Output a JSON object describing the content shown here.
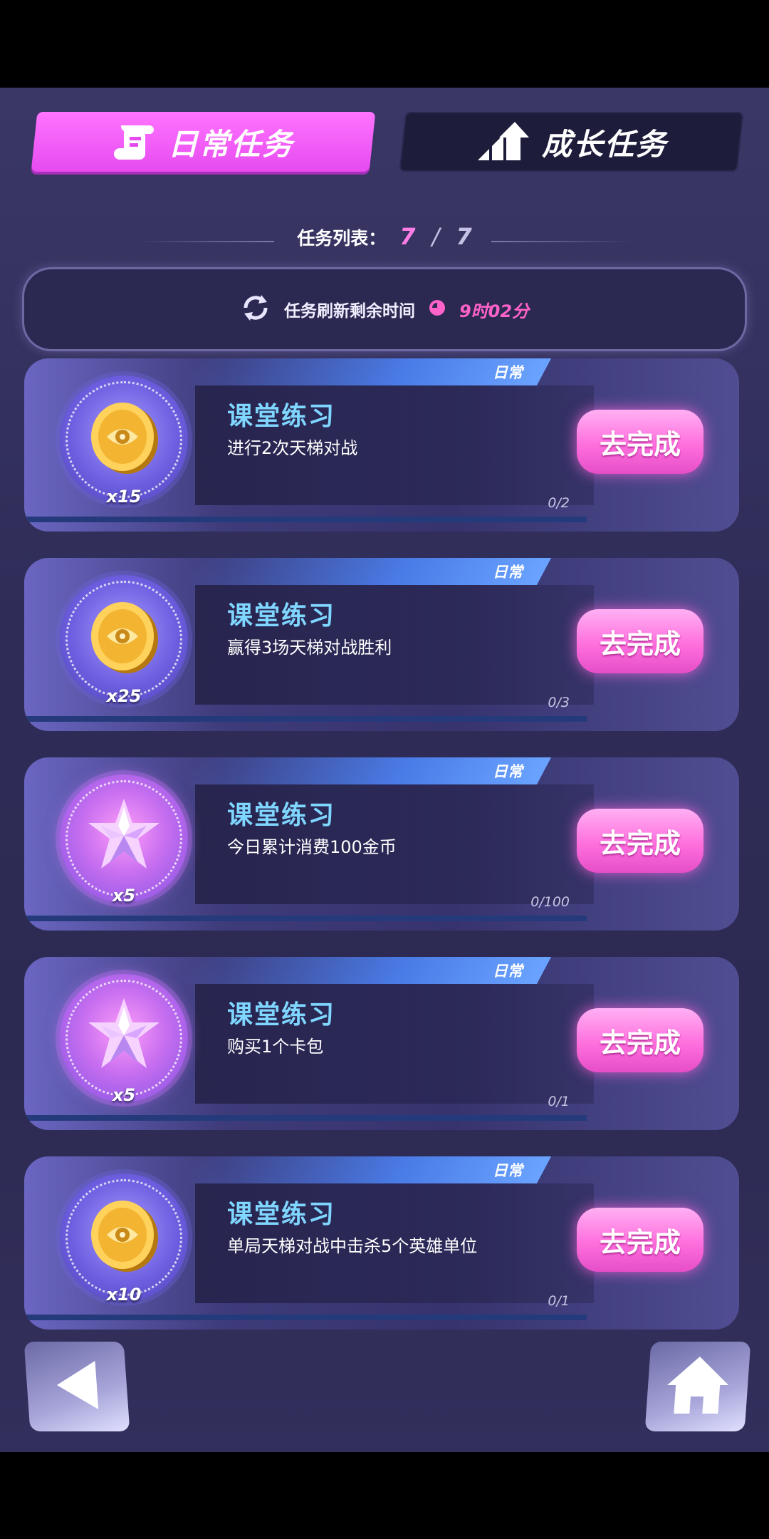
{
  "tabs": {
    "daily_label": "日常任务",
    "growth_label": "成长任务"
  },
  "task_count": {
    "label": "任务列表：",
    "current": "7",
    "separator": "/",
    "total": "7"
  },
  "refresh": {
    "label": "任务刷新剩余时间",
    "time": "9时02分"
  },
  "tasks": [
    {
      "tag": "日常",
      "title": "课堂练习",
      "desc": "进行2次天梯对战",
      "reward_icon": "coin-icon",
      "reward_qty": "x15",
      "progress": "0/2",
      "button": "去完成"
    },
    {
      "tag": "日常",
      "title": "课堂练习",
      "desc": "赢得3场天梯对战胜利",
      "reward_icon": "coin-icon",
      "reward_qty": "x25",
      "progress": "0/3",
      "button": "去完成"
    },
    {
      "tag": "日常",
      "title": "课堂练习",
      "desc": "今日累计消费100金币",
      "reward_icon": "star-crystal-icon",
      "reward_qty": "x5",
      "progress": "0/100",
      "button": "去完成"
    },
    {
      "tag": "日常",
      "title": "课堂练习",
      "desc": "购买1个卡包",
      "reward_icon": "star-crystal-icon",
      "reward_qty": "x5",
      "progress": "0/1",
      "button": "去完成"
    },
    {
      "tag": "日常",
      "title": "课堂练习",
      "desc": "单局天梯对战中击杀5个英雄单位",
      "reward_icon": "coin-icon",
      "reward_qty": "x10",
      "progress": "0/1",
      "button": "去完成"
    }
  ],
  "colors": {
    "accent_pink": "#ff6fdd",
    "title_blue": "#7fd6ff",
    "timer_pink": "#ff62c8"
  }
}
